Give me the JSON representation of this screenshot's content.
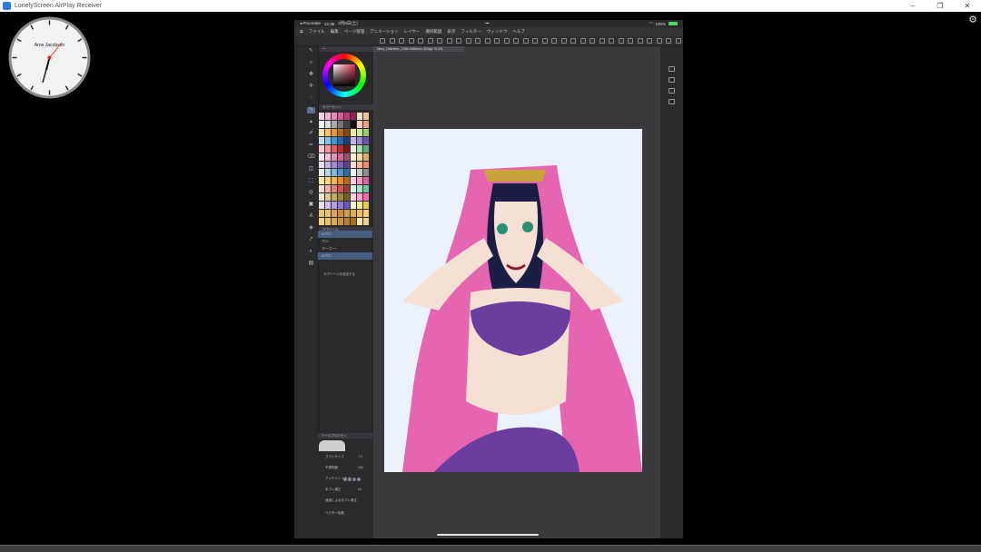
{
  "window": {
    "title": "LonelyScreen AirPlay Receiver"
  },
  "clock": {
    "label": "Arne Jacobsen"
  },
  "ipad": {
    "status": {
      "app": "◂ Procreate",
      "time": "12:35",
      "date": "2月6日(土)",
      "dots": "•••",
      "battery": "100%"
    },
    "menu": [
      "ファイル",
      "編集",
      "ページ管理",
      "アニメーション",
      "レイヤー",
      "選択範囲",
      "表示",
      "フィルター",
      "ウィンドウ",
      "ヘルプ"
    ],
    "doc_tab": "Nima_Definitive_2786×3686mm 300dpi 70.4%",
    "panels": {
      "color_history": "カラーセット",
      "subtool_header": "サブツール",
      "subtools": [
        "Gペン",
        "ペン",
        "マーカー",
        "Gペン"
      ],
      "add_subtool": "サブツールを追加する",
      "tool_property": "ツールプロパティ",
      "props": [
        "ブラシサイズ",
        "不透明度",
        "アンチエイリアス",
        "手ブレ補正",
        "速度による手ブレ補正",
        "ベクター吸着"
      ],
      "prop_values": [
        "7.0",
        "100",
        "",
        "84"
      ]
    }
  },
  "colors": {
    "accent": "#5a6b8f",
    "ipad_bg": "#2b2b2e",
    "canvas_bg": "#eaf1fb"
  }
}
